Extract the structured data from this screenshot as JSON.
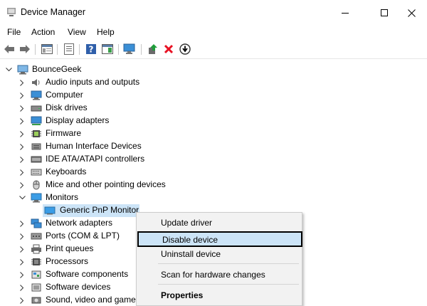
{
  "window": {
    "title": "Device Manager"
  },
  "menubar": {
    "items": [
      "File",
      "Action",
      "View",
      "Help"
    ]
  },
  "toolbar": {
    "buttons": [
      "back-icon",
      "forward-icon",
      "properties-pane-icon",
      "details-icon",
      "help-icon",
      "action-pane-icon",
      "scan-hardware-icon",
      "update-driver-icon",
      "uninstall-icon",
      "disable-icon"
    ]
  },
  "tree": {
    "root": "BounceGeek",
    "categories": [
      {
        "label": "Audio inputs and outputs",
        "icon": "speaker-icon",
        "expanded": false
      },
      {
        "label": "Computer",
        "icon": "computer-icon",
        "expanded": false
      },
      {
        "label": "Disk drives",
        "icon": "disk-drive-icon",
        "expanded": false
      },
      {
        "label": "Display adapters",
        "icon": "display-adapter-icon",
        "expanded": false
      },
      {
        "label": "Firmware",
        "icon": "firmware-icon",
        "expanded": false
      },
      {
        "label": "Human Interface Devices",
        "icon": "hid-icon",
        "expanded": false
      },
      {
        "label": "IDE ATA/ATAPI controllers",
        "icon": "ide-controller-icon",
        "expanded": false
      },
      {
        "label": "Keyboards",
        "icon": "keyboard-icon",
        "expanded": false
      },
      {
        "label": "Mice and other pointing devices",
        "icon": "mouse-icon",
        "expanded": false
      },
      {
        "label": "Monitors",
        "icon": "monitor-icon",
        "expanded": true,
        "children": [
          "Generic PnP Monitor"
        ]
      },
      {
        "label": "Network adapters",
        "icon": "network-adapter-icon",
        "expanded": false
      },
      {
        "label": "Ports (COM & LPT)",
        "icon": "port-icon",
        "expanded": false
      },
      {
        "label": "Print queues",
        "icon": "printer-icon",
        "expanded": false
      },
      {
        "label": "Processors",
        "icon": "processor-icon",
        "expanded": false
      },
      {
        "label": "Software components",
        "icon": "software-component-icon",
        "expanded": false
      },
      {
        "label": "Software devices",
        "icon": "software-device-icon",
        "expanded": false
      },
      {
        "label": "Sound, video and game",
        "icon": "sound-icon",
        "expanded": false
      }
    ]
  },
  "context_menu": {
    "items": [
      "Update driver",
      "Disable device",
      "Uninstall device",
      "Scan for hardware changes",
      "Properties"
    ],
    "selected": "Disable device",
    "default": "Properties"
  },
  "colors": {
    "selection": "#cce4f7",
    "monitor_blue": "#2d9be0",
    "delete_red": "#e81123",
    "update_green": "#1e9e3a"
  }
}
